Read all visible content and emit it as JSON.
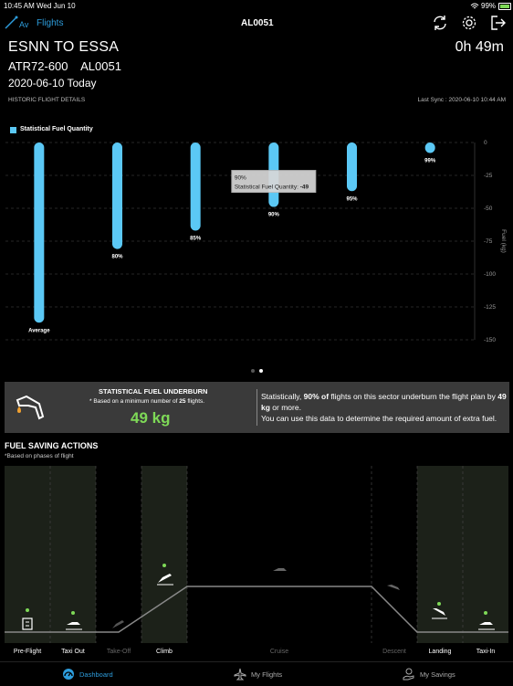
{
  "status_bar": {
    "time": "10:45 AM",
    "date": "Wed Jun 10",
    "battery": "99%"
  },
  "nav": {
    "back_label": "Flights",
    "title": "AL0051"
  },
  "flight": {
    "route": "ESNN TO ESSA",
    "duration": "0h 49m",
    "aircraft": "ATR72-600",
    "flight_no": "AL0051",
    "date": "2020-06-10 Today",
    "section_label": "HISTORIC FLIGHT DETAILS",
    "last_sync": "Last Sync : 2020-06-10 10:44 AM"
  },
  "chart_data": {
    "type": "bar",
    "legend": "Statistical Fuel Quantity",
    "ylabel": "Fuel (kg)",
    "ylim": [
      -150,
      0
    ],
    "yticks": [
      0,
      -25,
      -50,
      -75,
      -100,
      -125,
      -150
    ],
    "categories": [
      "Average",
      "80%",
      "85%",
      "90%",
      "95%",
      "99%"
    ],
    "values": [
      -137,
      -81,
      -67,
      -49,
      -37,
      -8
    ],
    "tooltip": {
      "title": "90%",
      "label": "Statistical Fuel Quantity:",
      "value": "-49"
    },
    "color": "#5bc8f5"
  },
  "underburn": {
    "title": "STATISTICAL FUEL UNDERBURN",
    "basis_prefix": "* Based on a minimum number of",
    "basis_count": "25",
    "basis_suffix": "flights.",
    "value": "49 kg",
    "desc_1": "Statistically,",
    "desc_pct": "90% of",
    "desc_2": "flights on this sector underburn the flight plan by",
    "desc_kg": "49 kg",
    "desc_3": "or more.",
    "desc_4": "You can use this data to determine the required amount of extra fuel."
  },
  "fuel_saving": {
    "title": "FUEL SAVING ACTIONS",
    "subtitle": "*Based on phases of flight",
    "phases": [
      "Pre-Flight",
      "Taxi Out",
      "Take-Off",
      "Climb",
      "Cruise",
      "Descent",
      "Landing",
      "Taxi-In"
    ]
  },
  "tabs": {
    "dashboard": "Dashboard",
    "my_flights": "My Flights",
    "my_savings": "My Savings"
  },
  "colors": {
    "accent": "#2d9cdb",
    "bar": "#5bc8f5",
    "green": "#7ed957",
    "orange": "#f0a030"
  }
}
